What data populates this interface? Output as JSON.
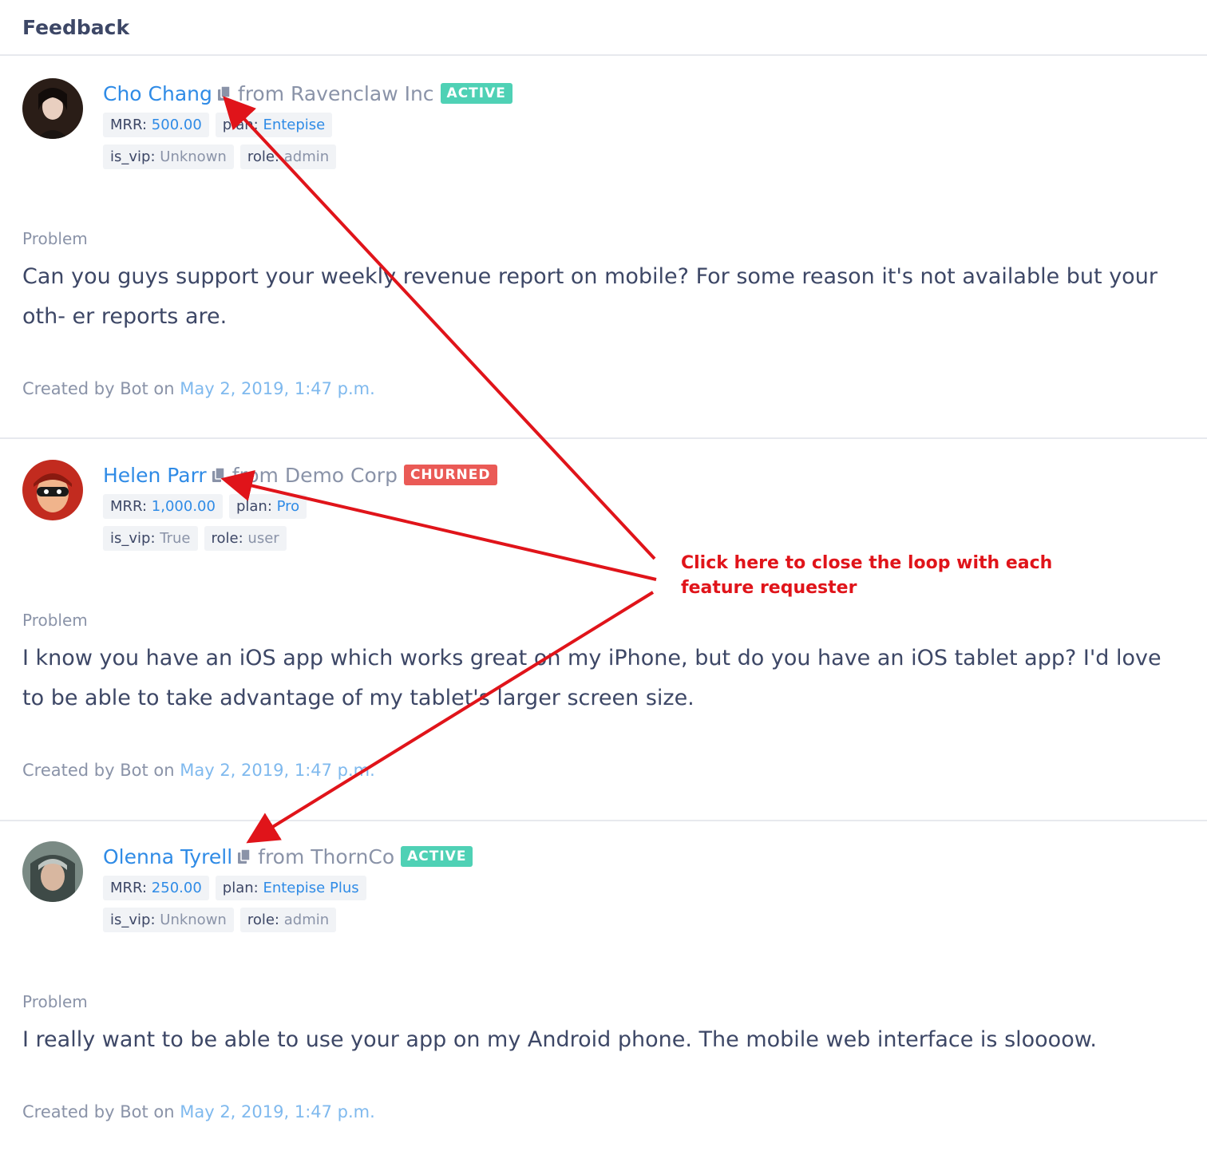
{
  "header": {
    "title": "Feedback"
  },
  "colors": {
    "active": "#4fd1b5",
    "churned": "#ea5a56",
    "link": "#2f8be6",
    "annotation": "#e0141a"
  },
  "entries": [
    {
      "name": "Cho Chang",
      "from": "from Ravenclaw Inc",
      "status": "ACTIVE",
      "tags": [
        {
          "key": "MRR:",
          "value": "500.00"
        },
        {
          "key": "plan:",
          "value": "Entepise"
        },
        {
          "key": "is_vip:",
          "value": "Unknown"
        },
        {
          "key": "role:",
          "value": "admin"
        }
      ],
      "section_label": "Problem",
      "text": "Can you guys support your weekly revenue report on mobile? For some reason it's not available but your oth- er reports are.",
      "created_prefix": "Created by Bot on",
      "created_date": "May 2, 2019, 1:47 p.m."
    },
    {
      "name": "Helen Parr",
      "from": "from Demo Corp",
      "status": "CHURNED",
      "tags": [
        {
          "key": "MRR:",
          "value": "1,000.00"
        },
        {
          "key": "plan:",
          "value": "Pro"
        },
        {
          "key": "is_vip:",
          "value": "True"
        },
        {
          "key": "role:",
          "value": "user"
        }
      ],
      "section_label": "Problem",
      "text": "I know you have an iOS app which works great on my iPhone, but do you have an iOS tablet app? I'd love to be able to take advantage of my tablet's larger screen size.",
      "created_prefix": "Created by Bot on",
      "created_date": "May 2, 2019, 1:47 p.m."
    },
    {
      "name": "Olenna Tyrell",
      "from": "from ThornCo",
      "status": "ACTIVE",
      "tags": [
        {
          "key": "MRR:",
          "value": "250.00"
        },
        {
          "key": "plan:",
          "value": "Entepise Plus"
        },
        {
          "key": "is_vip:",
          "value": "Unknown"
        },
        {
          "key": "role:",
          "value": "admin"
        }
      ],
      "section_label": "Problem",
      "text": "I really want to be able to use your app on my Android phone. The mobile web interface is sloooow.",
      "created_prefix": "Created by Bot on",
      "created_date": "May 2, 2019, 1:47 p.m."
    }
  ],
  "annotation": {
    "line1": "Click here to close the loop with each",
    "line2": "feature requester"
  }
}
